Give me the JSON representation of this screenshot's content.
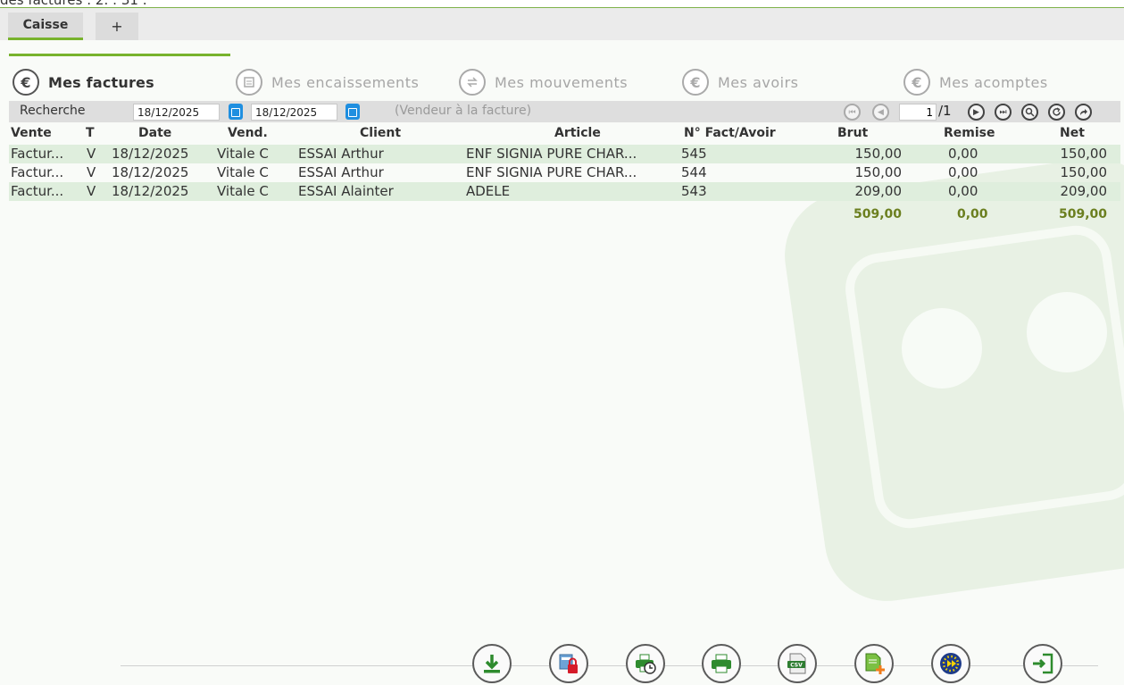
{
  "window": {
    "clipped_title": "des factures : 2. : 31 :"
  },
  "tabs": [
    {
      "label": "Caisse"
    },
    {
      "label": "+"
    }
  ],
  "nav": {
    "factures": "Mes factures",
    "encaissements": "Mes encaissements",
    "mouvements": "Mes mouvements",
    "avoirs": "Mes avoirs",
    "acomptes": "Mes acomptes"
  },
  "icons": {
    "euro": "euro-circle-icon",
    "cash_register": "cash-register-icon",
    "transfer": "transfer-icon"
  },
  "search": {
    "label": "Recherche",
    "date_from": "18/12/2025",
    "date_to": "18/12/2025",
    "vendeur_hint": "(Vendeur à la facture)",
    "page_value": "1",
    "page_total": "/1"
  },
  "table": {
    "headers": {
      "vente": "Vente",
      "t": "T",
      "date": "Date",
      "vend": "Vend.",
      "client": "Client",
      "article": "Article",
      "num": "N° Fact/Avoir",
      "brut": "Brut",
      "remise": "Remise",
      "net": "Net"
    },
    "rows": [
      {
        "vente": "Factur...",
        "t": "V",
        "date": "18/12/2025",
        "vend": "Vitale C",
        "client": "ESSAI Arthur",
        "article": "ENF SIGNIA PURE CHAR...",
        "num": "545",
        "brut": "150,00",
        "remise": "0,00",
        "net": "150,00"
      },
      {
        "vente": "Factur...",
        "t": "V",
        "date": "18/12/2025",
        "vend": "Vitale C",
        "client": "ESSAI Arthur",
        "article": "ENF SIGNIA PURE CHAR...",
        "num": "544",
        "brut": "150,00",
        "remise": "0,00",
        "net": "150,00"
      },
      {
        "vente": "Factur...",
        "t": "V",
        "date": "18/12/2025",
        "vend": "Vitale C",
        "client": "ESSAI Alainter",
        "article": "ADELE",
        "num": "543",
        "brut": "209,00",
        "remise": "0,00",
        "net": "209,00"
      }
    ],
    "totals": {
      "brut": "509,00",
      "remise": "0,00",
      "net": "509,00"
    }
  },
  "colors": {
    "accent_green": "#78b32d",
    "totals_text": "#6b7f1f",
    "row_alt": "#dfeedd",
    "calendar_blue": "#1f8fe0"
  }
}
